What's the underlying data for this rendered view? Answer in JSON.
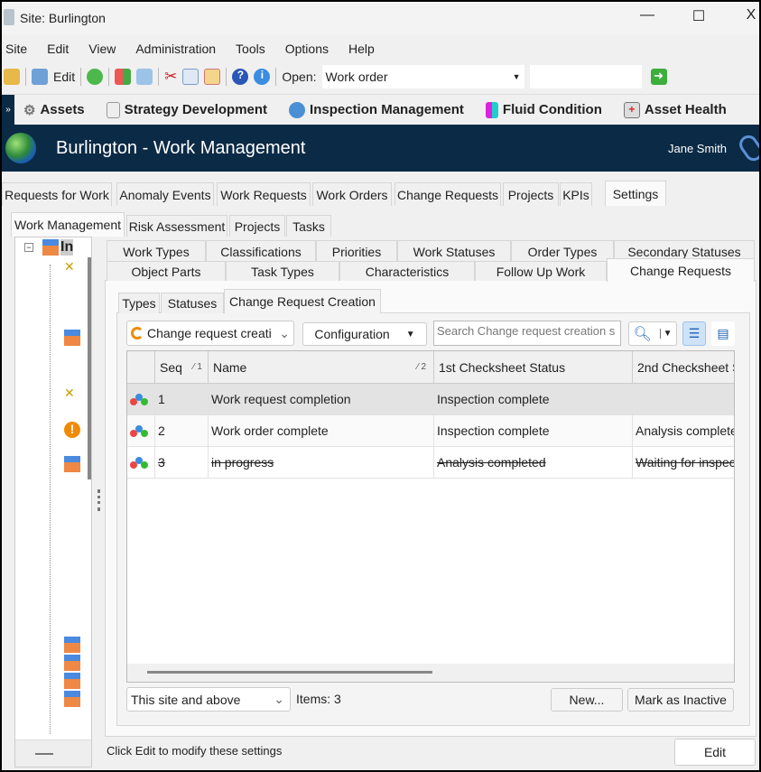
{
  "window": {
    "title": "Site: Burlington",
    "minimize": "—",
    "maximize": "☐",
    "close": "X"
  },
  "menu": [
    "Site",
    "Edit",
    "View",
    "Administration",
    "Tools",
    "Options",
    "Help"
  ],
  "toolbar": {
    "edit_label": "Edit",
    "open_label": "Open:",
    "open_value": "Work order",
    "open_input": ""
  },
  "modules": [
    "Assets",
    "Strategy Development",
    "Inspection Management",
    "Fluid Condition",
    "Asset Health"
  ],
  "header": {
    "title": "Burlington - Work Management",
    "user": "Jane Smith"
  },
  "main_tabs": [
    "Requests for Work",
    "Anomaly Events",
    "Work Requests",
    "Work Orders",
    "Change Requests",
    "Projects",
    "KPIs",
    "Settings"
  ],
  "settings_tabs": [
    "Work Management",
    "Risk Assessment",
    "Projects",
    "Tasks"
  ],
  "tree": {
    "root_label": "In"
  },
  "config_tabs_row1": [
    "Work Types",
    "Classifications",
    "Priorities",
    "Work Statuses",
    "Order Types",
    "Secondary Statuses"
  ],
  "config_tabs_row2": [
    "Object Parts",
    "Task Types",
    "Characteristics",
    "Follow Up Work",
    "Change Requests"
  ],
  "cr_tabs": [
    "Types",
    "Statuses",
    "Change Request Creation"
  ],
  "grid_toolbar": {
    "view_select": "Change request creati",
    "configuration": "Configuration",
    "search_placeholder": "Search Change request creation s"
  },
  "grid": {
    "columns": [
      {
        "label": "Seq",
        "sort": "1"
      },
      {
        "label": "Name",
        "sort": "2"
      },
      {
        "label": "1st Checksheet Status"
      },
      {
        "label": "2nd Checksheet S"
      }
    ],
    "rows": [
      {
        "seq": "1",
        "name": "Work request completion",
        "first": "Inspection complete",
        "second": "",
        "selected": true,
        "inactive": false
      },
      {
        "seq": "2",
        "name": "Work order complete",
        "first": "Inspection complete",
        "second": "Analysis completed",
        "selected": false,
        "inactive": false
      },
      {
        "seq": "3",
        "name": "in progress",
        "first": "Analysis completed",
        "second": "Waiting for inspect",
        "selected": false,
        "inactive": true
      }
    ]
  },
  "footer": {
    "scope": "This site and above",
    "items": "Items: 3",
    "new": "New...",
    "mark_inactive": "Mark as Inactive"
  },
  "status": {
    "message": "Click Edit to modify these settings",
    "edit": "Edit"
  },
  "colors": {
    "header_bg": "#0b2a45",
    "selected_row": "#e3e3e3"
  }
}
